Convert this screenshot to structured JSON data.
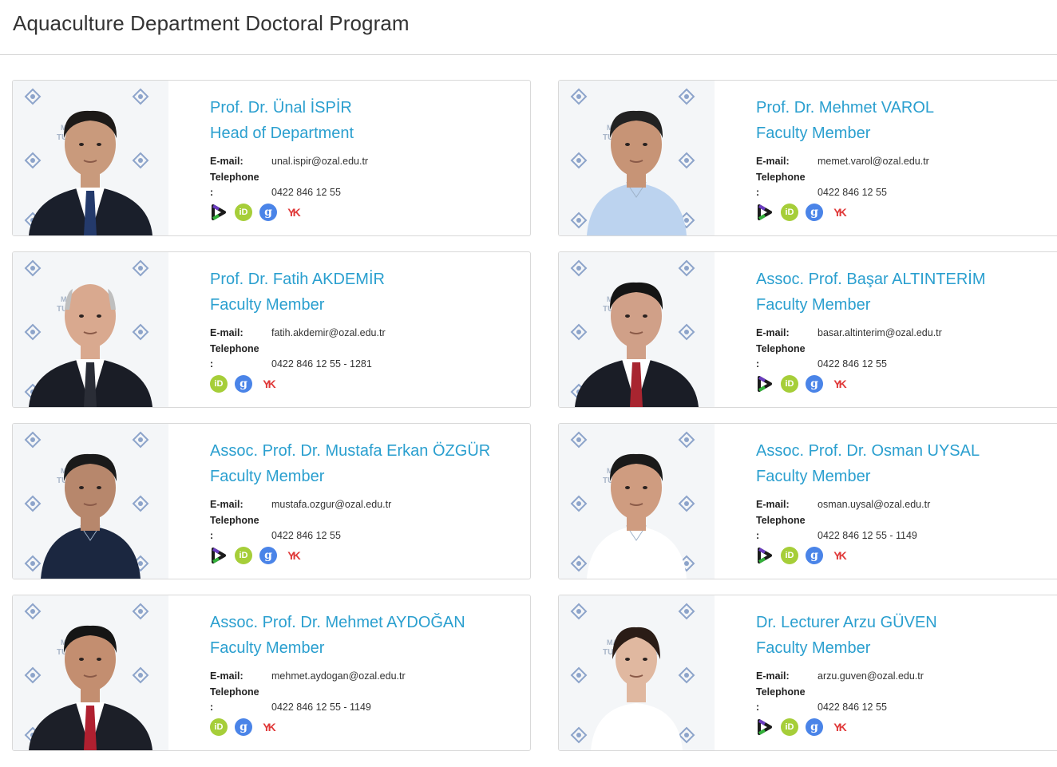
{
  "page": {
    "title": "Aquaculture Department Doctoral Program"
  },
  "labels": {
    "email": "E-mail:",
    "telephone": "Telephone",
    "colon": ":"
  },
  "people": [
    {
      "name": "Prof. Dr. Ünal İSPİR",
      "role": "Head of Department",
      "email": "unal.ispir@ozal.edu.tr",
      "phone": "0422 846 12 55",
      "icons": [
        "publons-icon",
        "orcid-icon",
        "google-scholar-icon",
        "yok-icon"
      ]
    },
    {
      "name": "Prof. Dr. Mehmet VAROL",
      "role": "Faculty Member",
      "email": "memet.varol@ozal.edu.tr",
      "phone": "0422 846 12 55",
      "icons": [
        "publons-icon",
        "orcid-icon",
        "google-scholar-icon",
        "yok-icon"
      ]
    },
    {
      "name": "Prof. Dr. Fatih AKDEMİR",
      "role": "Faculty Member",
      "email": "fatih.akdemir@ozal.edu.tr",
      "phone": "0422 846 12 55 - 1281",
      "icons": [
        "orcid-icon",
        "google-scholar-icon",
        "yok-icon"
      ]
    },
    {
      "name": "Assoc. Prof. Başar ALTINTERİM",
      "role": "Faculty Member",
      "email": "basar.altinterim@ozal.edu.tr",
      "phone": "0422 846 12 55",
      "icons": [
        "publons-icon",
        "orcid-icon",
        "google-scholar-icon",
        "yok-icon"
      ]
    },
    {
      "name": "Assoc. Prof. Dr. Mustafa Erkan ÖZGÜR",
      "role": "Faculty Member",
      "email": "mustafa.ozgur@ozal.edu.tr",
      "phone": "0422 846 12 55",
      "icons": [
        "publons-icon",
        "orcid-icon",
        "google-scholar-icon",
        "yok-icon"
      ]
    },
    {
      "name": "Assoc. Prof. Dr. Osman UYSAL",
      "role": "Faculty Member",
      "email": "osman.uysal@ozal.edu.tr",
      "phone": "0422 846 12 55 - 1149",
      "icons": [
        "publons-icon",
        "orcid-icon",
        "google-scholar-icon",
        "yok-icon"
      ]
    },
    {
      "name": "Assoc. Prof. Dr. Mehmet AYDOĞAN",
      "role": "Faculty Member",
      "email": "mehmet.aydogan@ozal.edu.tr",
      "phone": "0422 846 12 55 - 1149",
      "icons": [
        "orcid-icon",
        "google-scholar-icon",
        "yok-icon"
      ]
    },
    {
      "name": "Dr. Lecturer Arzu GÜVEN",
      "role": "Faculty Member",
      "email": "arzu.guven@ozal.edu.tr",
      "phone": "0422 846 12 55",
      "icons": [
        "publons-icon",
        "orcid-icon",
        "google-scholar-icon",
        "yok-icon"
      ]
    }
  ],
  "icon_text": {
    "orcid": "iD",
    "scholar": "g",
    "yok": "YK"
  },
  "colors": {
    "link": "#2a9fcf",
    "orcid": "#a6ce39",
    "scholar": "#4a84e8",
    "yok": "#e03a3a"
  }
}
